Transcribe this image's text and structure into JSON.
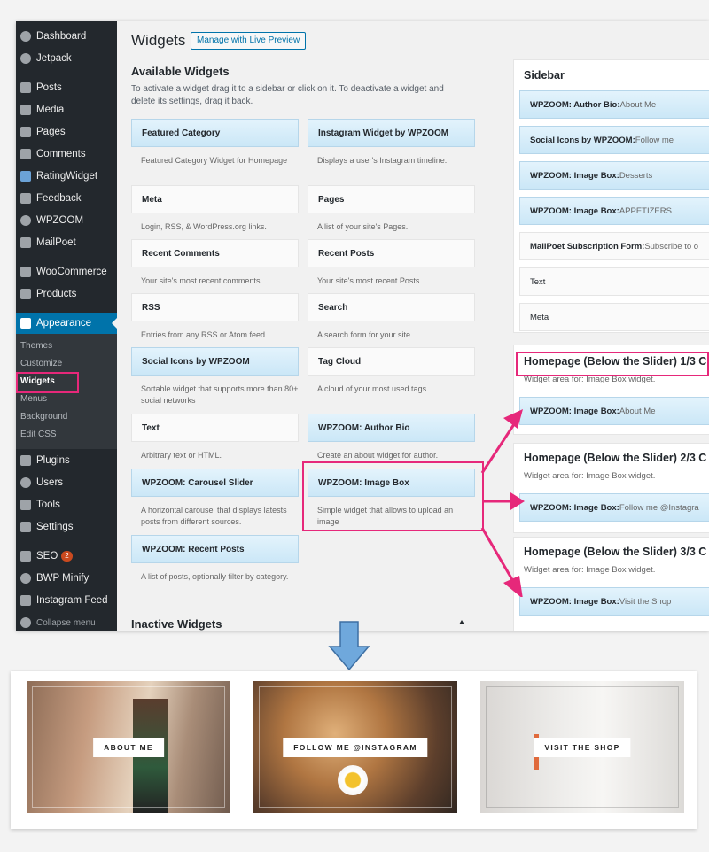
{
  "sidebar": {
    "items": [
      {
        "label": "Dashboard",
        "icon": "dashboard-icon"
      },
      {
        "label": "Jetpack",
        "icon": "jetpack-icon"
      },
      {
        "label": "Posts",
        "icon": "pin-icon"
      },
      {
        "label": "Media",
        "icon": "media-icon"
      },
      {
        "label": "Pages",
        "icon": "page-icon"
      },
      {
        "label": "Comments",
        "icon": "comment-icon"
      },
      {
        "label": "RatingWidget",
        "icon": "star-icon"
      },
      {
        "label": "Feedback",
        "icon": "feedback-icon"
      },
      {
        "label": "WPZOOM",
        "icon": "wpzoom-icon"
      },
      {
        "label": "MailPoet",
        "icon": "mailpoet-icon"
      },
      {
        "label": "WooCommerce",
        "icon": "woo-icon"
      },
      {
        "label": "Products",
        "icon": "product-icon"
      },
      {
        "label": "Appearance",
        "icon": "brush-icon"
      },
      {
        "label": "Plugins",
        "icon": "plugin-icon"
      },
      {
        "label": "Users",
        "icon": "user-icon"
      },
      {
        "label": "Tools",
        "icon": "wrench-icon"
      },
      {
        "label": "Settings",
        "icon": "settings-icon"
      },
      {
        "label": "SEO",
        "icon": "seo-icon",
        "badge": "2"
      },
      {
        "label": "BWP Minify",
        "icon": "gear-icon"
      },
      {
        "label": "Instagram Feed",
        "icon": "instagram-icon"
      },
      {
        "label": "Collapse menu",
        "icon": "collapse-icon"
      }
    ],
    "submenu": [
      "Themes",
      "Customize",
      "Widgets",
      "Menus",
      "Background",
      "Edit CSS"
    ]
  },
  "header": {
    "title": "Widgets",
    "preview_button": "Manage with Live Preview"
  },
  "available": {
    "title": "Available Widgets",
    "description": "To activate a widget drag it to a sidebar or click on it. To deactivate a widget and delete its settings, drag it back.",
    "widgets": [
      {
        "name": "Featured Category",
        "desc": "Featured Category Widget for Homepage"
      },
      {
        "name": "Instagram Widget by WPZOOM",
        "desc": "Displays a user's Instagram timeline."
      },
      {
        "name": "Meta",
        "desc": "Login, RSS, & WordPress.org links."
      },
      {
        "name": "Pages",
        "desc": "A list of your site's Pages."
      },
      {
        "name": "Recent Comments",
        "desc": "Your site's most recent comments."
      },
      {
        "name": "Recent Posts",
        "desc": "Your site's most recent Posts."
      },
      {
        "name": "RSS",
        "desc": "Entries from any RSS or Atom feed."
      },
      {
        "name": "Search",
        "desc": "A search form for your site."
      },
      {
        "name": "Social Icons by WPZOOM",
        "desc": "Sortable widget that supports more than 80+ social networks"
      },
      {
        "name": "Tag Cloud",
        "desc": "A cloud of your most used tags."
      },
      {
        "name": "Text",
        "desc": "Arbitrary text or HTML."
      },
      {
        "name": "WPZOOM: Author Bio",
        "desc": "Create an about widget for author."
      },
      {
        "name": "WPZOOM: Carousel Slider",
        "desc": "A horizontal carousel that displays latests posts from different sources."
      },
      {
        "name": "WPZOOM: Image Box",
        "desc": "Simple widget that allows to upload an image"
      },
      {
        "name": "WPZOOM: Recent Posts",
        "desc": "A list of posts, optionally filter by category."
      }
    ]
  },
  "inactive": {
    "title": "Inactive Widgets"
  },
  "sidebar_area": {
    "title": "Sidebar",
    "widgets": [
      {
        "name": "WPZOOM: Author Bio:",
        "sub": " About Me"
      },
      {
        "name": "Social Icons by WPZOOM:",
        "sub": " Follow me"
      },
      {
        "name": "WPZOOM: Image Box:",
        "sub": " Desserts"
      },
      {
        "name": "WPZOOM: Image Box:",
        "sub": " APPETIZERS"
      },
      {
        "name": "MailPoet Subscription Form:",
        "sub": " Subscribe to o"
      },
      {
        "name": "Text",
        "sub": ""
      },
      {
        "name": "Meta",
        "sub": ""
      }
    ]
  },
  "homepage_areas": [
    {
      "title": "Homepage (Below the Slider) 1/3 C",
      "desc": "Widget area for: Image Box widget.",
      "widget": "WPZOOM: Image Box:",
      "sub": " About Me"
    },
    {
      "title": "Homepage (Below the Slider) 2/3 C",
      "desc": "Widget area for: Image Box widget.",
      "widget": "WPZOOM: Image Box:",
      "sub": " Follow me @Instagra"
    },
    {
      "title": "Homepage (Below the Slider) 3/3 C",
      "desc": "Widget area for: Image Box widget.",
      "widget": "WPZOOM: Image Box:",
      "sub": " Visit the Shop"
    }
  ],
  "preview_tiles": [
    {
      "label": "ABOUT ME"
    },
    {
      "label": "FOLLOW ME @INSTAGRAM"
    },
    {
      "label": "VISIT THE SHOP"
    }
  ],
  "colors": {
    "highlight": "#e6287a",
    "admin_bg": "#23282d",
    "active": "#0073aa",
    "down_arrow": "#6fa8dc"
  }
}
